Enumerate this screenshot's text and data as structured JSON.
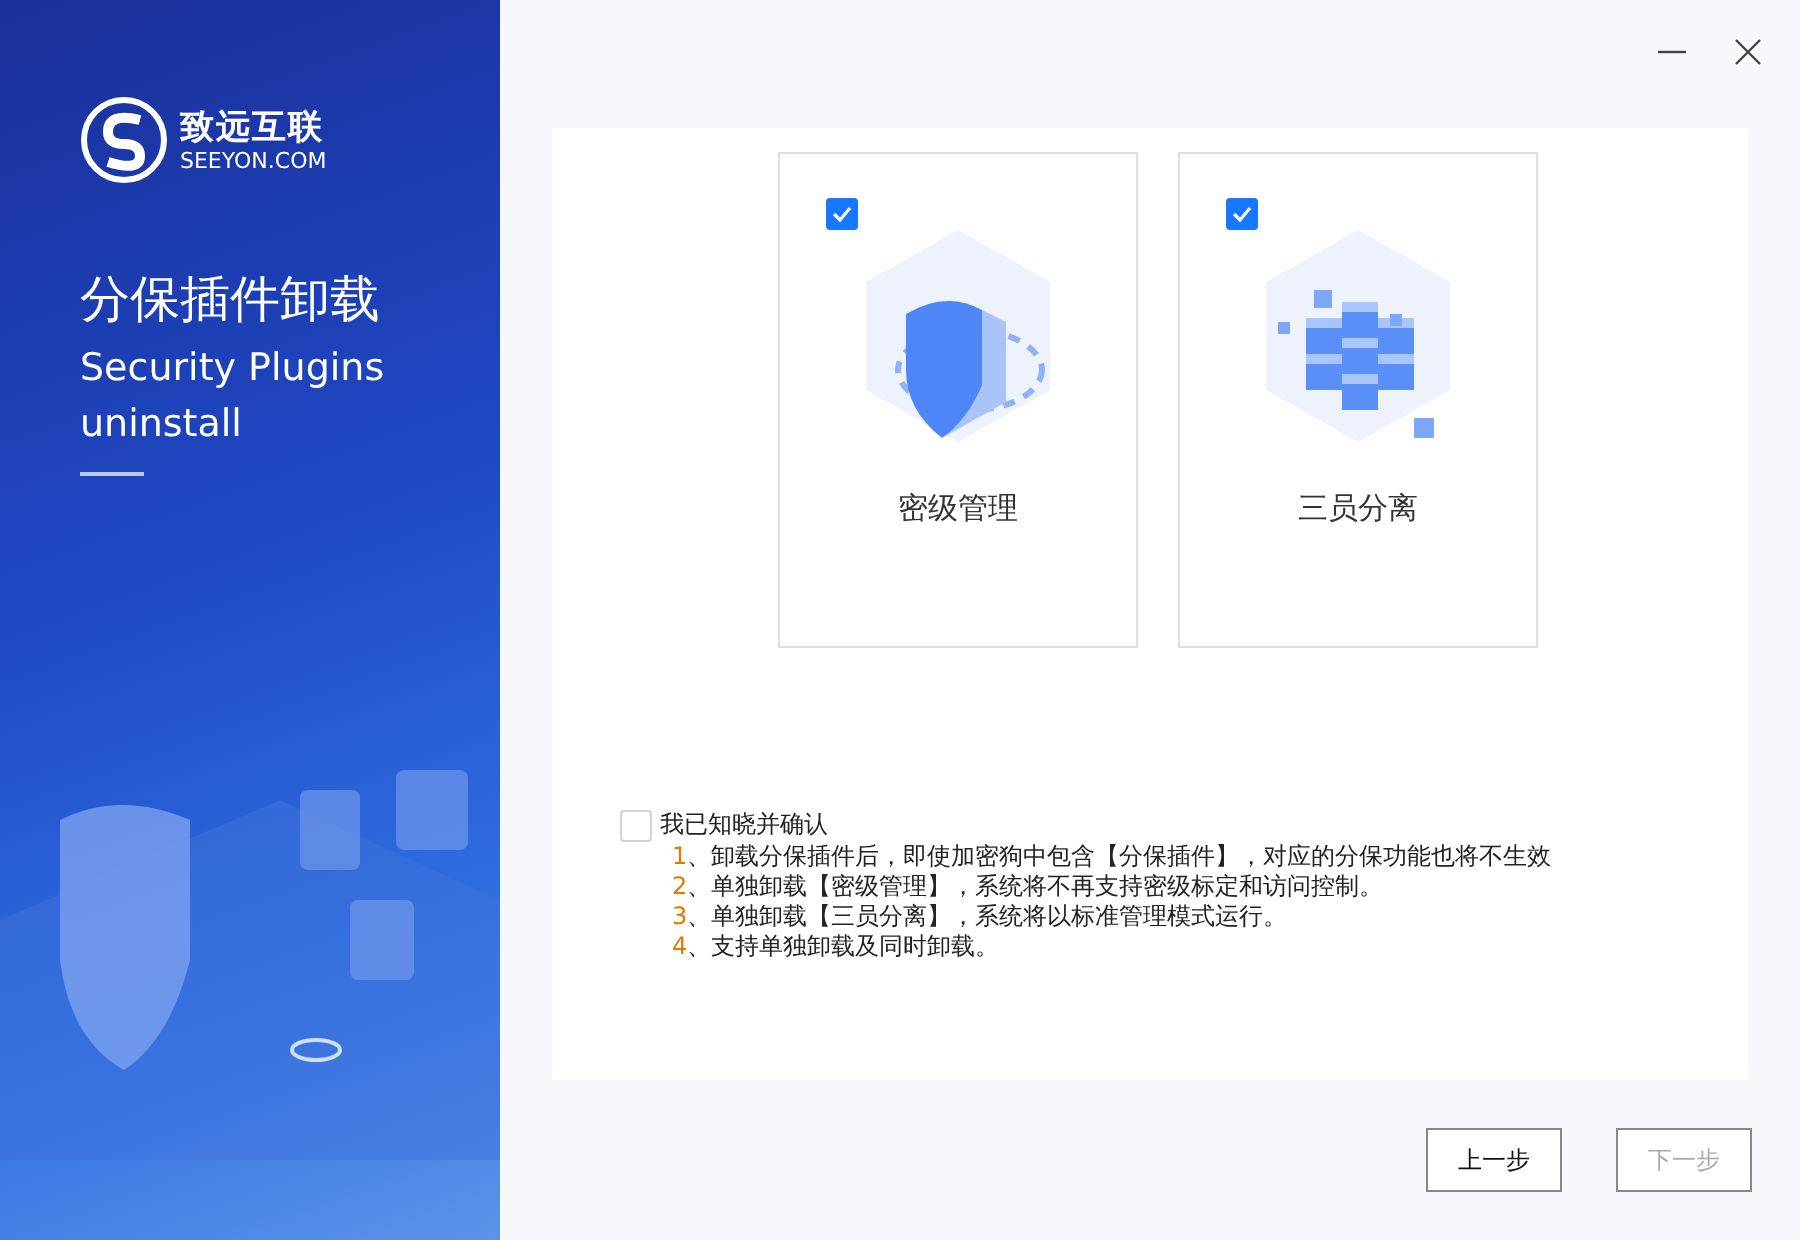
{
  "brand": {
    "name": "致远互联",
    "domain": "SEEYON.COM"
  },
  "sidebar": {
    "title": "分保插件卸载",
    "subtitle": "Security Plugins uninstall"
  },
  "options": [
    {
      "label": "密级管理",
      "kind": "shield",
      "checked": true
    },
    {
      "label": "三员分离",
      "kind": "cubes",
      "checked": true
    }
  ],
  "confirm": {
    "label": "我已知晓并确认",
    "checked": false
  },
  "notes": [
    {
      "number": "1",
      "text": "、卸载分保插件后，即使加密狗中包含【分保插件】，对应的分保功能也将不生效"
    },
    {
      "number": "2",
      "text": "、单独卸载【密级管理】，系统将不再支持密级标定和访问控制。"
    },
    {
      "number": "3",
      "text": "、单独卸载【三员分离】，系统将以标准管理模式运行。"
    },
    {
      "number": "4",
      "text": "、支持单独卸载及同时卸载。"
    }
  ],
  "buttons": [
    {
      "label": "上一步",
      "disabled": false
    },
    {
      "label": "下一步",
      "disabled": true
    }
  ]
}
